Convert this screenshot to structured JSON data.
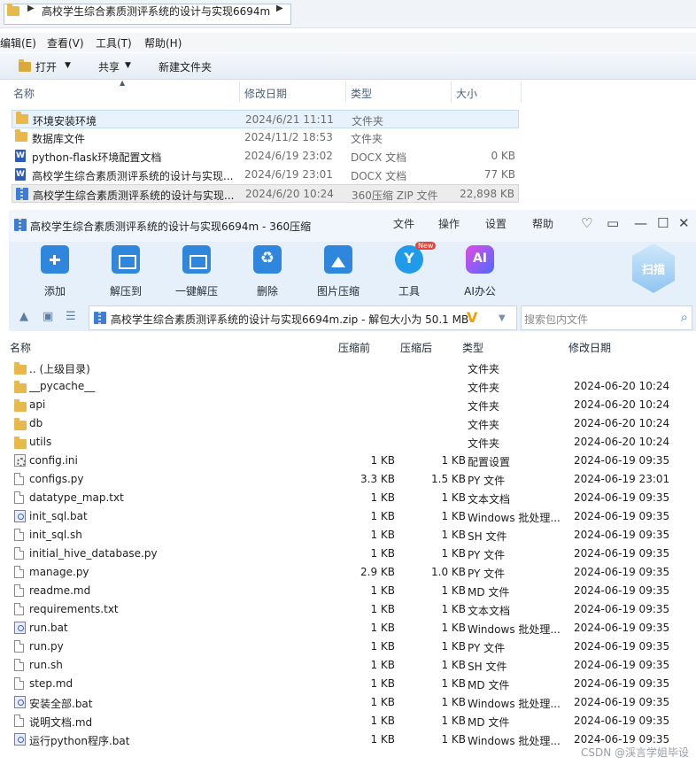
{
  "explorer": {
    "path": "高校学生综合素质测评系统的设计与实现6694m",
    "menu": [
      "编辑(E)",
      "查看(V)",
      "工具(T)",
      "帮助(H)"
    ],
    "toolbar": {
      "open": "打开",
      "share": "共享",
      "new_folder": "新建文件夹"
    },
    "columns": {
      "name": "名称",
      "date": "修改日期",
      "type": "类型",
      "size": "大小"
    },
    "rows": [
      {
        "name": "环境安装环境",
        "date": "2024/6/21 11:11",
        "type": "文件夹",
        "size": "",
        "icon": "folder-icon"
      },
      {
        "name": "数据库文件",
        "date": "2024/11/2 18:53",
        "type": "文件夹",
        "size": "",
        "icon": "folder-icon"
      },
      {
        "name": "python-flask环境配置文档",
        "date": "2024/6/19 23:02",
        "type": "DOCX 文档",
        "size": "0 KB",
        "icon": "docx-icon"
      },
      {
        "name": "高校学生综合素质测评系统的设计与实现...",
        "date": "2024/6/19 23:01",
        "type": "DOCX 文档",
        "size": "77 KB",
        "icon": "docx-icon"
      },
      {
        "name": "高校学生综合素质测评系统的设计与实现...",
        "date": "2024/6/20 10:24",
        "type": "360压缩 ZIP 文件",
        "size": "22,898 KB",
        "icon": "zip-icon"
      }
    ]
  },
  "zip": {
    "title": "高校学生综合素质测评系统的设计与实现6694m - 360压缩",
    "menu": [
      "文件",
      "操作",
      "设置",
      "帮助"
    ],
    "ribbon": [
      "添加",
      "解压到",
      "一键解压",
      "删除",
      "图片压缩",
      "工具",
      "AI办公"
    ],
    "new_badge": "New",
    "scan": "扫描",
    "path": "高校学生综合素质测评系统的设计与实现6694m.zip - 解包大小为 50.1 MB",
    "search_placeholder": "搜索包内文件",
    "columns": {
      "name": "名称",
      "before": "压缩前",
      "after": "压缩后",
      "type": "类型",
      "date": "修改日期"
    },
    "rows": [
      {
        "name": ".. (上级目录)",
        "before": "",
        "after": "",
        "type": "文件夹",
        "date": "",
        "icon": "folder"
      },
      {
        "name": "__pycache__",
        "before": "",
        "after": "",
        "type": "文件夹",
        "date": "2024-06-20 10:24",
        "icon": "folder"
      },
      {
        "name": "api",
        "before": "",
        "after": "",
        "type": "文件夹",
        "date": "2024-06-20 10:24",
        "icon": "folder"
      },
      {
        "name": "db",
        "before": "",
        "after": "",
        "type": "文件夹",
        "date": "2024-06-20 10:24",
        "icon": "folder"
      },
      {
        "name": "utils",
        "before": "",
        "after": "",
        "type": "文件夹",
        "date": "2024-06-20 10:24",
        "icon": "folder"
      },
      {
        "name": "config.ini",
        "before": "1 KB",
        "after": "1 KB",
        "type": "配置设置",
        "date": "2024-06-19 09:35",
        "icon": "ini"
      },
      {
        "name": "configs.py",
        "before": "3.3 KB",
        "after": "1.5 KB",
        "type": "PY 文件",
        "date": "2024-06-19 23:01",
        "icon": "file"
      },
      {
        "name": "datatype_map.txt",
        "before": "1 KB",
        "after": "1 KB",
        "type": "文本文档",
        "date": "2024-06-19 09:35",
        "icon": "file"
      },
      {
        "name": "init_sql.bat",
        "before": "1 KB",
        "after": "1 KB",
        "type": "Windows 批处理...",
        "date": "2024-06-19 09:35",
        "icon": "bat"
      },
      {
        "name": "init_sql.sh",
        "before": "1 KB",
        "after": "1 KB",
        "type": "SH 文件",
        "date": "2024-06-19 09:35",
        "icon": "file"
      },
      {
        "name": "initial_hive_database.py",
        "before": "1 KB",
        "after": "1 KB",
        "type": "PY 文件",
        "date": "2024-06-19 09:35",
        "icon": "file"
      },
      {
        "name": "manage.py",
        "before": "2.9 KB",
        "after": "1.0 KB",
        "type": "PY 文件",
        "date": "2024-06-19 09:35",
        "icon": "file"
      },
      {
        "name": "readme.md",
        "before": "1 KB",
        "after": "1 KB",
        "type": "MD 文件",
        "date": "2024-06-19 09:35",
        "icon": "file"
      },
      {
        "name": "requirements.txt",
        "before": "1 KB",
        "after": "1 KB",
        "type": "文本文档",
        "date": "2024-06-19 09:35",
        "icon": "file"
      },
      {
        "name": "run.bat",
        "before": "1 KB",
        "after": "1 KB",
        "type": "Windows 批处理...",
        "date": "2024-06-19 09:35",
        "icon": "bat"
      },
      {
        "name": "run.py",
        "before": "1 KB",
        "after": "1 KB",
        "type": "PY 文件",
        "date": "2024-06-19 09:35",
        "icon": "file"
      },
      {
        "name": "run.sh",
        "before": "1 KB",
        "after": "1 KB",
        "type": "SH 文件",
        "date": "2024-06-19 09:35",
        "icon": "file"
      },
      {
        "name": "step.md",
        "before": "1 KB",
        "after": "1 KB",
        "type": "MD 文件",
        "date": "2024-06-19 09:35",
        "icon": "file"
      },
      {
        "name": "安装全部.bat",
        "before": "1 KB",
        "after": "1 KB",
        "type": "Windows 批处理...",
        "date": "2024-06-19 09:35",
        "icon": "bat"
      },
      {
        "name": "说明文档.md",
        "before": "1 KB",
        "after": "1 KB",
        "type": "MD 文件",
        "date": "2024-06-19 09:35",
        "icon": "file"
      },
      {
        "name": "运行python程序.bat",
        "before": "1 KB",
        "after": "1 KB",
        "type": "Windows 批处理...",
        "date": "2024-06-19 09:35",
        "icon": "bat"
      }
    ]
  },
  "watermark": "CSDN @渓言学姐毕设"
}
